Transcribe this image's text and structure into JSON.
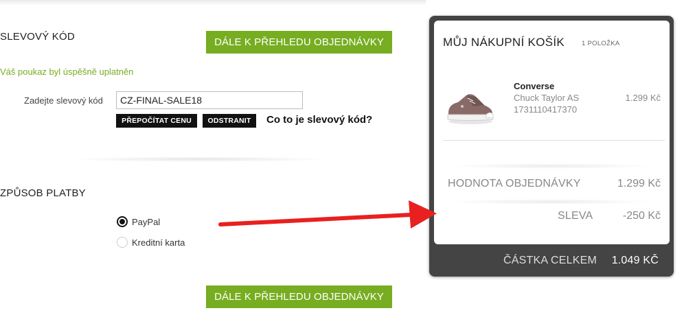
{
  "discount": {
    "section_title": "SLEVOVÝ KÓD",
    "continue_label": "DÁLE K PŘEHLEDU OBJEDNÁVKY",
    "success_message": "Váš poukaz byl úspěšně uplatněn",
    "field_label": "Zadejte slevový kód",
    "code_value": "CZ-FINAL-SALE18",
    "recalculate_label": "PŘEPOČÍTAT CENU",
    "remove_label": "ODSTRANIT",
    "help_link": "Co to je slevový kód?"
  },
  "payment": {
    "section_title": "ZPŮSOB PLATBY",
    "options": [
      {
        "label": "PayPal",
        "selected": true
      },
      {
        "label": "Kreditní karta",
        "selected": false
      }
    ],
    "continue_label": "DÁLE K PŘEHLEDU OBJEDNÁVKY"
  },
  "cart": {
    "title": "MŮJ NÁKUPNÍ KOŠÍK",
    "item_count": "1 POLOŽKA",
    "item": {
      "brand": "Converse",
      "name": "Chuck Taylor AS",
      "sku": "1731110417370",
      "price": "1.299 Kč",
      "image_icon": "shoe-icon"
    },
    "order_value_label": "HODNOTA OBJEDNÁVKY",
    "order_value": "1.299 Kč",
    "discount_label": "SLEVA",
    "discount_value": "-250 Kč",
    "total_label": "ČÁSTKA CELKEM",
    "total_value": "1.049 KČ"
  },
  "colors": {
    "accent_green": "#77ad21",
    "arrow_red": "#e8201f",
    "cart_dark": "#444444"
  }
}
